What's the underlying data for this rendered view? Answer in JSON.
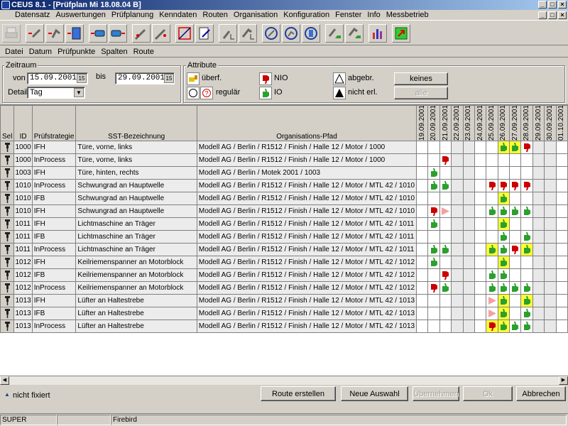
{
  "window": {
    "title": "CEUS 8.1 - [Prüfplan Mi 18.08.04 B]"
  },
  "menu": [
    "Datensatz",
    "Auswertungen",
    "Prüfplanung",
    "Kenndaten",
    "Routen",
    "Organisation",
    "Konfiguration",
    "Fenster",
    "Info",
    "Messbetrieb"
  ],
  "submenu": [
    "Datei",
    "Datum",
    "Prüfpunkte",
    "Spalten",
    "Route"
  ],
  "zeitraum": {
    "label": "Zeitraum",
    "von_label": "von",
    "von_value": "15.09.2001",
    "bis_label": "bis",
    "bis_value": "29.09.2001",
    "detail_label": "Detail",
    "detail_value": "Tag"
  },
  "attribute": {
    "label": "Attribute",
    "ueberf": "überf.",
    "regulaer": "regulär",
    "nio": "NIO",
    "io": "IO",
    "abgebr": "abgebr.",
    "nicht_erl": "nicht erl.",
    "keines_btn": "keines",
    "alle_btn": "alle"
  },
  "columns": {
    "sel": "Sel",
    "id": "ID",
    "strategie": "Prüfstrategie",
    "bez": "SST-Bezeichnung",
    "pfad": "Organisations-Pfad"
  },
  "dates": [
    "19.09.2001",
    "20.09.2001",
    "21.09.2001",
    "22.09.2001",
    "23.09.2001",
    "24.09.2001",
    "25.09.2001",
    "26.09.2001",
    "27.09.2001",
    "28.09.2001",
    "29.09.2001",
    "30.09.2001",
    "01.10.2001"
  ],
  "weekend": [
    3,
    4,
    10,
    11
  ],
  "rows": [
    {
      "id": "1000",
      "strat": "IFH",
      "bez": "Türe, vorne, links",
      "pfad": "Modell AG / Berlin / R1512 / Finish / Halle 12 / Motor / 1000",
      "cells": {
        "7": "g",
        "8": "g",
        "9": "r"
      },
      "hl": [
        7,
        8
      ]
    },
    {
      "id": "1000",
      "strat": "InProcess",
      "bez": "Türe, vorne, links",
      "pfad": "Modell AG / Berlin / R1512 / Finish / Halle 12 / Motor / 1000",
      "cells": {
        "2": "r"
      },
      "hl": []
    },
    {
      "id": "1003",
      "strat": "IFH",
      "bez": "Türe, hinten, rechts",
      "pfad": "Modell AG / Berlin / Motek 2001 / 1003",
      "cells": {
        "1": "g"
      },
      "hl": []
    },
    {
      "id": "1010",
      "strat": "InProcess",
      "bez": "Schwungrad an Hauptwelle",
      "pfad": "Modell AG / Berlin / R1512 / Finish / Halle 12 / Motor / MTL 42 / 1010",
      "cells": {
        "1": "g",
        "2": "g",
        "6": "r",
        "7": "r",
        "8": "r",
        "9": "r"
      },
      "hl": []
    },
    {
      "id": "1010",
      "strat": "IFB",
      "bez": "Schwungrad an Hauptwelle",
      "pfad": "Modell AG / Berlin / R1512 / Finish / Halle 12 / Motor / MTL 42 / 1010",
      "cells": {
        "7": "g"
      },
      "hl": [
        7
      ]
    },
    {
      "id": "1010",
      "strat": "IFH",
      "bez": "Schwungrad an Hauptwelle",
      "pfad": "Modell AG / Berlin / R1512 / Finish / Halle 12 / Motor / MTL 42 / 1010",
      "cells": {
        "1": "r",
        "2": "p",
        "6": "g",
        "7": "g",
        "8": "g",
        "9": "g"
      },
      "hl": []
    },
    {
      "id": "1011",
      "strat": "IFH",
      "bez": "Lichtmaschine an Träger",
      "pfad": "Modell AG / Berlin / R1512 / Finish / Halle 12 / Motor / MTL 42 / 1011",
      "cells": {
        "1": "g",
        "7": "g"
      },
      "hl": [
        7
      ]
    },
    {
      "id": "1011",
      "strat": "IFB",
      "bez": "Lichtmaschine an Träger",
      "pfad": "Modell AG / Berlin / R1512 / Finish / Halle 12 / Motor / MTL 42 / 1011",
      "cells": {
        "7": "g",
        "9": "g"
      },
      "hl": []
    },
    {
      "id": "1011",
      "strat": "InProcess",
      "bez": "Lichtmaschine an Träger",
      "pfad": "Modell AG / Berlin / R1512 / Finish / Halle 12 / Motor / MTL 42 / 1011",
      "cells": {
        "1": "g",
        "2": "g",
        "6": "g",
        "7": "g",
        "8": "r",
        "9": "g"
      },
      "hl": [
        6,
        9
      ]
    },
    {
      "id": "1012",
      "strat": "IFH",
      "bez": "Keilriemenspanner an Motorblock",
      "pfad": "Modell AG / Berlin / R1512 / Finish / Halle 12 / Motor / MTL 42 / 1012",
      "cells": {
        "1": "g",
        "7": "g"
      },
      "hl": [
        7
      ]
    },
    {
      "id": "1012",
      "strat": "IFB",
      "bez": "Keilriemenspanner an Motorblock",
      "pfad": "Modell AG / Berlin / R1512 / Finish / Halle 12 / Motor / MTL 42 / 1012",
      "cells": {
        "2": "r",
        "6": "g",
        "7": "g"
      },
      "hl": []
    },
    {
      "id": "1012",
      "strat": "InProcess",
      "bez": "Keilriemenspanner an Motorblock",
      "pfad": "Modell AG / Berlin / R1512 / Finish / Halle 12 / Motor / MTL 42 / 1012",
      "cells": {
        "1": "r",
        "2": "g",
        "6": "g",
        "7": "g",
        "8": "g",
        "9": "g"
      },
      "hl": []
    },
    {
      "id": "1013",
      "strat": "IFH",
      "bez": "Lüfter an Haltestrebe",
      "pfad": "Modell AG / Berlin / R1512 / Finish / Halle 12 / Motor / MTL 42 / 1013",
      "cells": {
        "6": "p",
        "7": "g",
        "9": "g"
      },
      "hl": [
        7,
        9
      ]
    },
    {
      "id": "1013",
      "strat": "IFB",
      "bez": "Lüfter an Haltestrebe",
      "pfad": "Modell AG / Berlin / R1512 / Finish / Halle 12 / Motor / MTL 42 / 1013",
      "cells": {
        "6": "p",
        "7": "g",
        "9": "g"
      },
      "hl": [
        7
      ]
    },
    {
      "id": "1013",
      "strat": "InProcess",
      "bez": "Lüfter an Haltestrebe",
      "pfad": "Modell AG / Berlin / R1512 / Finish / Halle 12 / Motor / MTL 42 / 1013",
      "cells": {
        "6": "r",
        "7": "g",
        "8": "g",
        "9": "g"
      },
      "hl": [
        6,
        7
      ]
    }
  ],
  "footer": {
    "nicht_fixiert": "nicht fixiert",
    "route_erstellen": "Route erstellen",
    "neue_auswahl": "Neue Auswahl",
    "uebernehmen": "Übernehmen",
    "ok": "Ok",
    "abbrechen": "Abbrechen"
  },
  "status": {
    "user": "SUPER",
    "db": "Firebird"
  },
  "colors": {
    "io_green": "#2ca02c",
    "nio_red": "#cc0000",
    "pending_pink": "#f4a0a0",
    "highlight": "#ffff33"
  }
}
